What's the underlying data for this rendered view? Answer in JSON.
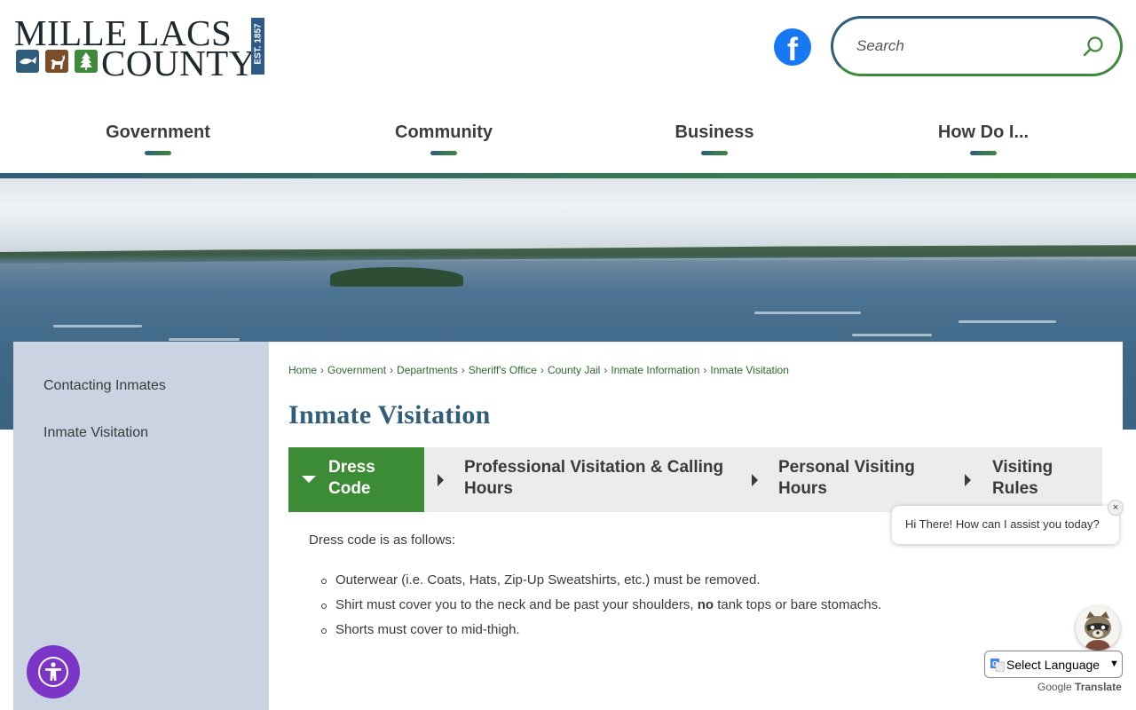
{
  "header": {
    "logo_line1": "MILLE LACS",
    "logo_line2": "COUNTY",
    "logo_est": "EST. 1857",
    "search_placeholder": "Search"
  },
  "nav": {
    "items": [
      {
        "label": "Government"
      },
      {
        "label": "Community"
      },
      {
        "label": "Business"
      },
      {
        "label": "How Do I..."
      }
    ]
  },
  "sidebar": {
    "items": [
      {
        "label": "Contacting Inmates"
      },
      {
        "label": "Inmate Visitation"
      }
    ]
  },
  "breadcrumb": [
    "Home",
    "Government",
    "Departments",
    "Sheriff's Office",
    "County Jail",
    "Inmate Information",
    "Inmate Visitation"
  ],
  "page_title": "Inmate Visitation",
  "tabs": [
    {
      "label_l1": "Dress",
      "label_l2": "Code",
      "active": true
    },
    {
      "label_l1": "Professional Visitation & Calling",
      "label_l2": "Hours",
      "active": false
    },
    {
      "label_l1": "Personal Visiting",
      "label_l2": "Hours",
      "active": false
    },
    {
      "label_l1": "Visiting",
      "label_l2": "Rules",
      "active": false
    }
  ],
  "content": {
    "intro": "Dress code is as follows:",
    "items": [
      {
        "text": "Outerwear (i.e. Coats, Hats, Zip-Up Sweatshirts, etc.) must be removed."
      },
      {
        "before": "Shirt must cover you to the neck and be past your shoulders, ",
        "bold": "no",
        "after": " tank tops or bare stomachs."
      },
      {
        "text": "Shorts must cover to mid-thigh."
      }
    ]
  },
  "chat": {
    "message": "Hi There! How can I assist you today?",
    "close": "×"
  },
  "translate": {
    "select_label": "Select Language",
    "powered_by": "Google",
    "translate_word": "Translate"
  },
  "colors": {
    "brand_blue": "#2f5d7a",
    "brand_green": "#3f8a3a",
    "active_tab": "#3c8c35",
    "sidebar_bg": "#c9d3e1",
    "a11y_purple": "#7c35c7"
  }
}
